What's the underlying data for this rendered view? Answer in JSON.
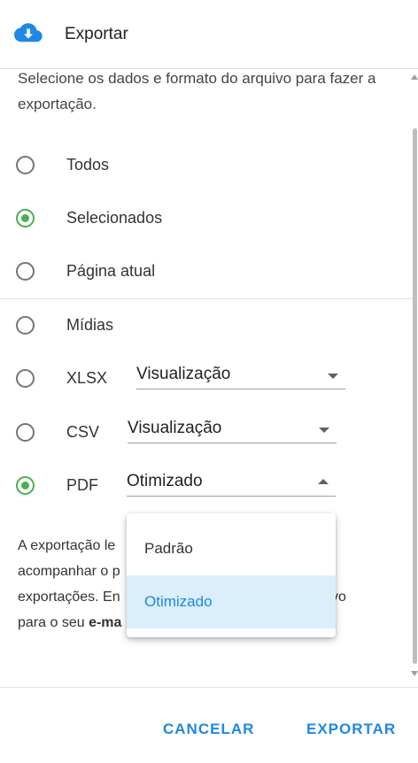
{
  "header": {
    "title": "Exportar",
    "icon": "cloud-download-icon",
    "accent": "#1e88e5"
  },
  "intro": "Selecione os dados e formato do arquivo para fazer a exportação.",
  "scope_options": [
    {
      "label": "Todos",
      "checked": false
    },
    {
      "label": "Selecionados",
      "checked": true
    },
    {
      "label": "Página atual",
      "checked": false
    }
  ],
  "media_option": {
    "label": "Mídias",
    "checked": false
  },
  "formats": [
    {
      "label": "XLSX",
      "checked": false,
      "select_value": "Visualização"
    },
    {
      "label": "CSV",
      "checked": false,
      "select_value": "Visualização"
    },
    {
      "label": "PDF",
      "checked": true,
      "select_value": "Otimizado",
      "open": true
    }
  ],
  "note": {
    "line1": "A exportação le",
    "line2": "acompanhar o p",
    "line3_a": "exportações. En",
    "line3_b": "vo",
    "line4": "para o seu ",
    "line4_bold": "e-ma"
  },
  "dropdown": {
    "options": [
      "Padrão",
      "Otimizado"
    ],
    "selected": "Otimizado"
  },
  "footer": {
    "cancel": "CANCELAR",
    "export": "EXPORTAR"
  },
  "colors": {
    "radio_checked": "#4caf50",
    "selected_bg": "#dbeefc"
  }
}
